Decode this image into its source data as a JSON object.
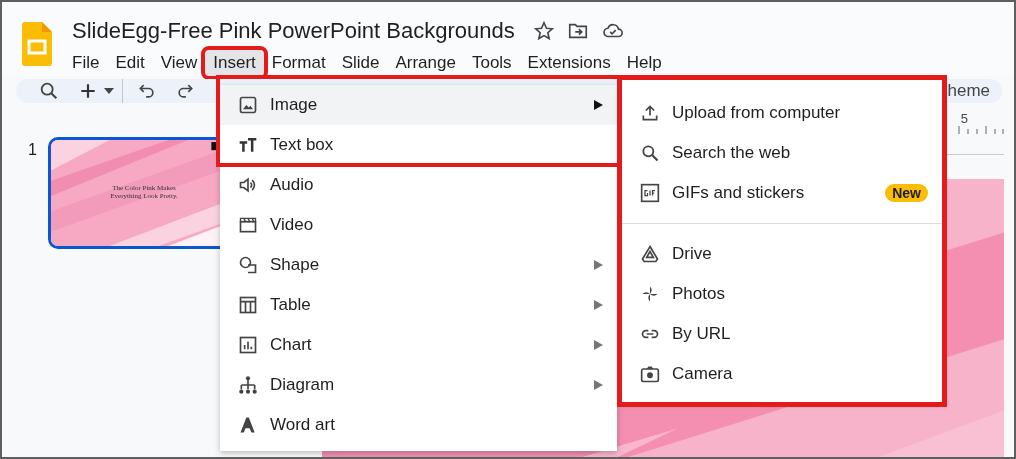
{
  "document": {
    "title": "SlideEgg-Free Pink PowerPoint Backgrounds"
  },
  "menu_bar": [
    {
      "label": "File",
      "selected": false,
      "highlighted": false
    },
    {
      "label": "Edit",
      "selected": false,
      "highlighted": false
    },
    {
      "label": "View",
      "selected": false,
      "highlighted": false
    },
    {
      "label": "Insert",
      "selected": true,
      "highlighted": true
    },
    {
      "label": "Format",
      "selected": false,
      "highlighted": false
    },
    {
      "label": "Slide",
      "selected": false,
      "highlighted": false
    },
    {
      "label": "Arrange",
      "selected": false,
      "highlighted": false
    },
    {
      "label": "Tools",
      "selected": false,
      "highlighted": false
    },
    {
      "label": "Extensions",
      "selected": false,
      "highlighted": false
    },
    {
      "label": "Help",
      "selected": false,
      "highlighted": false
    }
  ],
  "toolbar": {
    "theme_button": "heme"
  },
  "ruler": {
    "mark": "5"
  },
  "slides": [
    {
      "number": "1",
      "selected": true,
      "caption": "The Color Pink Makes Everything Look Pretty."
    }
  ],
  "insert_menu": [
    {
      "label": "Image",
      "submenu": true,
      "selected": true,
      "highlighted": true
    },
    {
      "label": "Text box",
      "submenu": false,
      "selected": false,
      "highlighted": true
    },
    {
      "label": "Audio",
      "submenu": false,
      "selected": false,
      "highlighted": false
    },
    {
      "label": "Video",
      "submenu": false,
      "selected": false,
      "highlighted": false
    },
    {
      "label": "Shape",
      "submenu": true,
      "selected": false,
      "highlighted": false
    },
    {
      "label": "Table",
      "submenu": true,
      "selected": false,
      "highlighted": false
    },
    {
      "label": "Chart",
      "submenu": true,
      "selected": false,
      "highlighted": false
    },
    {
      "label": "Diagram",
      "submenu": true,
      "selected": false,
      "highlighted": false
    },
    {
      "label": "Word art",
      "submenu": false,
      "selected": false,
      "highlighted": false
    }
  ],
  "image_submenu": {
    "highlighted": true,
    "groups": [
      [
        {
          "label": "Upload from computer"
        },
        {
          "label": "Search the web"
        },
        {
          "label": "GIFs and stickers",
          "badge": "New"
        }
      ],
      [
        {
          "label": "Drive"
        },
        {
          "label": "Photos"
        },
        {
          "label": "By URL"
        },
        {
          "label": "Camera"
        }
      ]
    ]
  }
}
